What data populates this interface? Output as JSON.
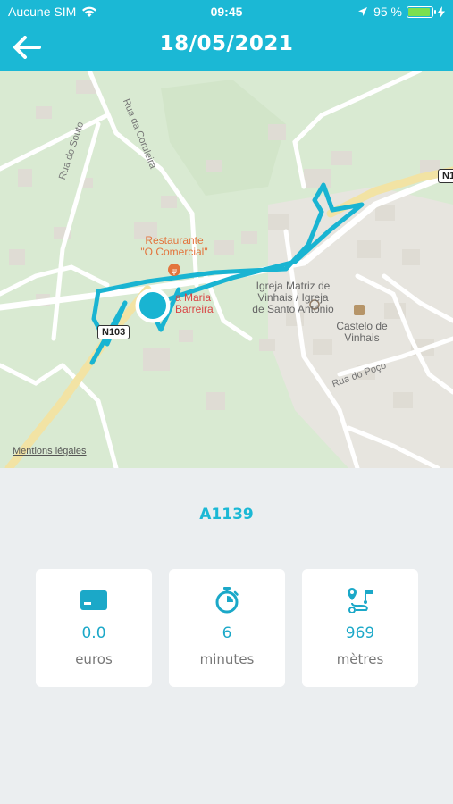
{
  "status_bar": {
    "carrier": "Aucune SIM",
    "time": "09:45",
    "battery": "95 %",
    "battery_level": 0.95
  },
  "header": {
    "title": "18/05/2021"
  },
  "map": {
    "legal_link": "Mentions légales",
    "pois": {
      "restaurant": "Restaurante\n\"O Comercial\"",
      "church": "Igreja Matriz de\nVinhais / Igreja\nde Santo António",
      "castle": "Castelo de\nVinhais",
      "maria": "a Maria\nBarreira"
    },
    "roads": {
      "souto": "Rua do Souto",
      "coruja": "Rua da Coruleira",
      "poco": "Rua do Poço"
    },
    "shields": {
      "n103": "N103",
      "n1": "N1"
    },
    "route_color": "#19b4d2"
  },
  "trip": {
    "vehicle_id": "A1139",
    "stats": [
      {
        "icon": "credit-card-icon",
        "value": "0.0",
        "unit": "euros"
      },
      {
        "icon": "stopwatch-icon",
        "value": "6",
        "unit": "minutes"
      },
      {
        "icon": "route-icon",
        "value": "969",
        "unit": "mètres"
      }
    ]
  },
  "colors": {
    "accent": "#1bb8d5",
    "background": "#ebeef0",
    "map_green": "#d9ead2"
  }
}
